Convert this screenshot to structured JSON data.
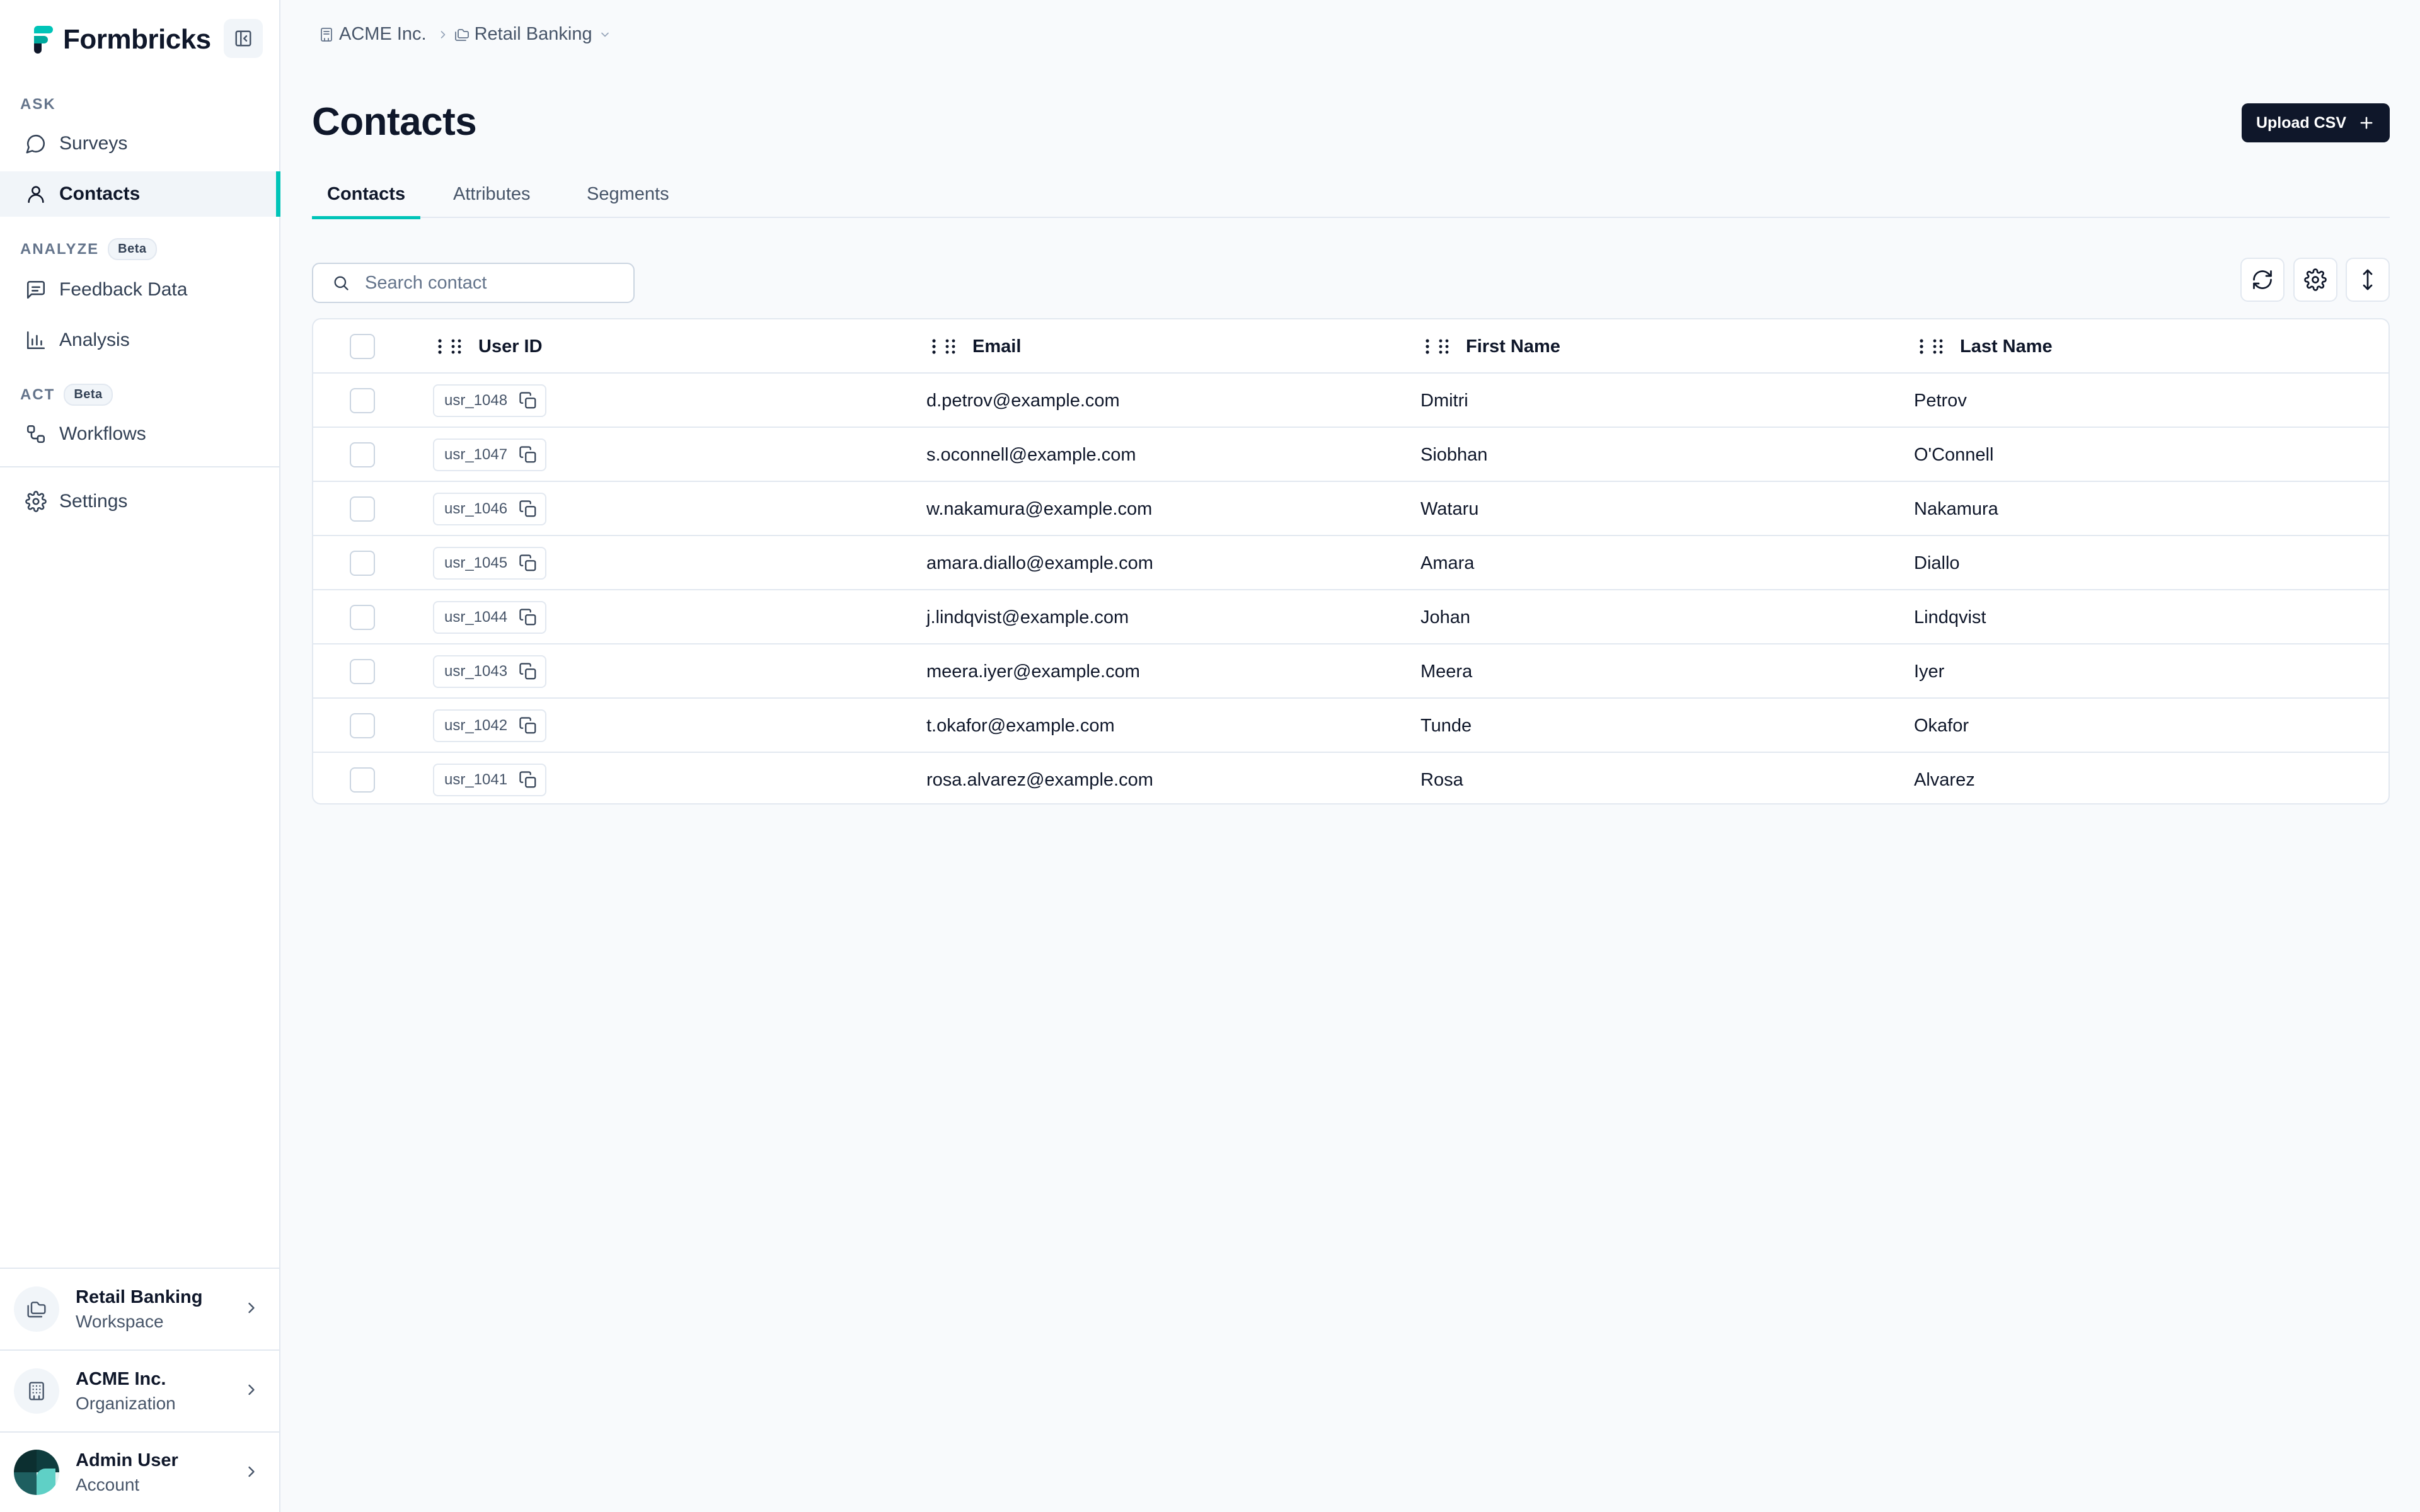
{
  "app": {
    "name": "Formbricks"
  },
  "sidebar": {
    "sections": {
      "ask": "ASK",
      "analyze": "ANALYZE",
      "act": "ACT",
      "beta": "Beta"
    },
    "items": {
      "surveys": "Surveys",
      "contacts": "Contacts",
      "feedback": "Feedback Data",
      "analysis": "Analysis",
      "workflows": "Workflows",
      "settings": "Settings"
    },
    "workspace": {
      "name": "Retail Banking",
      "type": "Workspace"
    },
    "organization": {
      "name": "ACME Inc.",
      "type": "Organization"
    },
    "account": {
      "name": "Admin User",
      "type": "Account"
    }
  },
  "breadcrumb": {
    "org": "ACME Inc.",
    "workspace": "Retail Banking"
  },
  "page": {
    "title": "Contacts",
    "upload_label": "Upload CSV"
  },
  "tabs": [
    "Contacts",
    "Attributes",
    "Segments"
  ],
  "search": {
    "placeholder": "Search contact",
    "value": ""
  },
  "table": {
    "columns": [
      "User ID",
      "Email",
      "First Name",
      "Last Name"
    ],
    "rows": [
      {
        "id": "usr_1048",
        "email": "d.petrov@example.com",
        "first": "Dmitri",
        "last": "Petrov"
      },
      {
        "id": "usr_1047",
        "email": "s.oconnell@example.com",
        "first": "Siobhan",
        "last": "O'Connell"
      },
      {
        "id": "usr_1046",
        "email": "w.nakamura@example.com",
        "first": "Wataru",
        "last": "Nakamura"
      },
      {
        "id": "usr_1045",
        "email": "amara.diallo@example.com",
        "first": "Amara",
        "last": "Diallo"
      },
      {
        "id": "usr_1044",
        "email": "j.lindqvist@example.com",
        "first": "Johan",
        "last": "Lindqvist"
      },
      {
        "id": "usr_1043",
        "email": "meera.iyer@example.com",
        "first": "Meera",
        "last": "Iyer"
      },
      {
        "id": "usr_1042",
        "email": "t.okafor@example.com",
        "first": "Tunde",
        "last": "Okafor"
      },
      {
        "id": "usr_1041",
        "email": "rosa.alvarez@example.com",
        "first": "Rosa",
        "last": "Alvarez"
      }
    ]
  },
  "icons": {
    "brand": "formbricks-logo-icon",
    "collapse": "sidebar-collapse-icon",
    "surveys": "message-circle-icon",
    "contacts": "user-icon",
    "feedback": "message-square-text-icon",
    "analysis": "bar-chart-icon",
    "workflows": "workflow-icon",
    "settings": "gear-icon",
    "refresh": "refresh-icon",
    "table_settings": "gear-icon",
    "row_density": "expand-vertical-icon",
    "copy": "copy-icon"
  },
  "colors": {
    "accent": "#00c4b8",
    "primary": "#0f172a",
    "background": "#f8fafc"
  }
}
